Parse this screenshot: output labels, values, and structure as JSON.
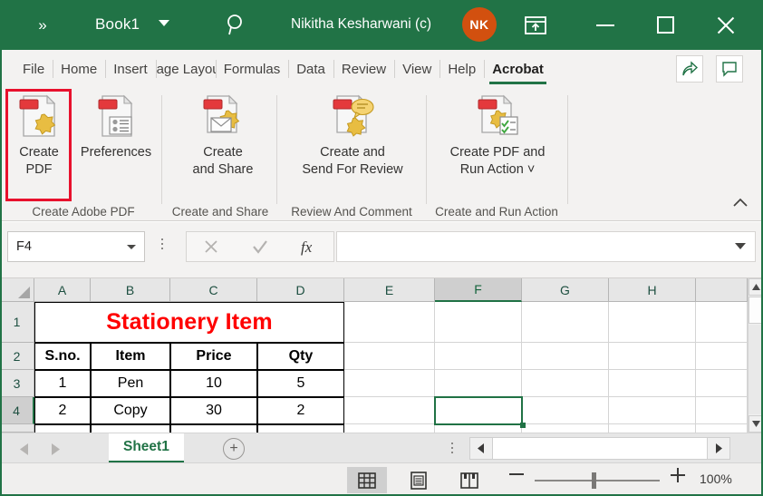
{
  "titlebar": {
    "qat_overflow": "»",
    "workbook_name": "Book1",
    "user_name": "Nikitha Kesharwani (c)",
    "avatar_initials": "NK",
    "green": "#217346",
    "avatar_color": "#d2500f"
  },
  "tabs": [
    {
      "label": "File",
      "active": false
    },
    {
      "label": "Home",
      "active": false
    },
    {
      "label": "Insert",
      "active": false
    },
    {
      "label": "Page Layout",
      "active": false
    },
    {
      "label": "Formulas",
      "active": false
    },
    {
      "label": "Data",
      "active": false
    },
    {
      "label": "Review",
      "active": false
    },
    {
      "label": "View",
      "active": false
    },
    {
      "label": "Help",
      "active": false
    },
    {
      "label": "Acrobat",
      "active": true
    }
  ],
  "ribbon": {
    "groups": [
      {
        "label": "Create Adobe PDF"
      },
      {
        "label": "Create and Share"
      },
      {
        "label": "Review And Comment"
      },
      {
        "label": "Create and Run Action"
      }
    ],
    "buttons": [
      {
        "label_line1": "Create",
        "label_line2": "PDF",
        "icon": "create-pdf-icon",
        "highlighted": true
      },
      {
        "label_line1": "Preferences",
        "label_line2": "",
        "icon": "preferences-icon",
        "highlighted": false
      },
      {
        "label_line1": "Create",
        "label_line2": "and Share",
        "icon": "create-and-share-icon",
        "highlighted": false
      },
      {
        "label_line1": "Create and",
        "label_line2": "Send For Review",
        "icon": "send-for-review-icon",
        "highlighted": false
      },
      {
        "label_line1": "Create PDF and",
        "label_line2": "Run Action ˅",
        "icon": "run-action-icon",
        "highlighted": false
      }
    ],
    "highlight_color": "#e8112d"
  },
  "formula_bar": {
    "name_box_value": "F4",
    "formula_value": "",
    "cancel_icon": "cancel-icon",
    "enter_icon": "enter-icon",
    "function_icon": "fx-icon"
  },
  "grid": {
    "columns": [
      "A",
      "B",
      "C",
      "D",
      "E",
      "F",
      "G",
      "H"
    ],
    "rows": [
      "1",
      "2",
      "3",
      "4"
    ],
    "selected_cell": "F4",
    "selected_column": "F",
    "selected_row": "4",
    "title_cell": "Stationery Item",
    "headers": [
      "S.no.",
      "Item",
      "Price",
      "Qty"
    ],
    "data_rows": [
      [
        "1",
        "Pen",
        "10",
        "5"
      ],
      [
        "2",
        "Copy",
        "30",
        "2"
      ]
    ],
    "title_color": "#ff0000"
  },
  "sheetbar": {
    "sheet_name": "Sheet1",
    "add_sheet_label": "+"
  },
  "statusbar": {
    "zoom_level": "100%",
    "views": [
      "normal-view",
      "page-layout-view",
      "page-break-preview"
    ],
    "active_view": "normal-view"
  }
}
